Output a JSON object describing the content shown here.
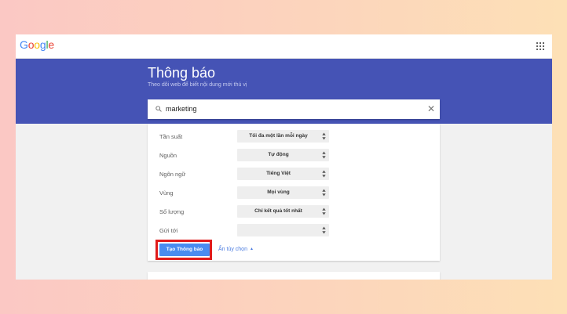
{
  "header": {
    "logo_letters": [
      {
        "ch": "G",
        "color": "#4285f4"
      },
      {
        "ch": "o",
        "color": "#ea4335"
      },
      {
        "ch": "o",
        "color": "#fbbc05"
      },
      {
        "ch": "g",
        "color": "#4285f4"
      },
      {
        "ch": "l",
        "color": "#34a853"
      },
      {
        "ch": "e",
        "color": "#ea4335"
      }
    ],
    "apps_icon": "apps-grid-icon"
  },
  "hero": {
    "title": "Thông báo",
    "subtitle": "Theo dõi web để biết nội dung mới thú vị",
    "background": "#4553b5"
  },
  "search": {
    "value": "marketing",
    "search_icon": "search-icon",
    "clear_icon": "close-icon",
    "clear_glyph": "✕"
  },
  "options": [
    {
      "label": "Tần suất",
      "value": "Tối đa một lần mỗi ngày"
    },
    {
      "label": "Nguồn",
      "value": "Tự động"
    },
    {
      "label": "Ngôn ngữ",
      "value": "Tiếng Việt"
    },
    {
      "label": "Vùng",
      "value": "Mọi vùng"
    },
    {
      "label": "Số lượng",
      "value": "Chỉ kết quả tốt nhất"
    },
    {
      "label": "Gửi tới",
      "value": ""
    }
  ],
  "actions": {
    "create_label": "Tạo Thông báo",
    "hide_options_label": "Ẩn tùy chọn",
    "accent": "#4a8cf0",
    "highlight_color": "#e01b1b"
  }
}
